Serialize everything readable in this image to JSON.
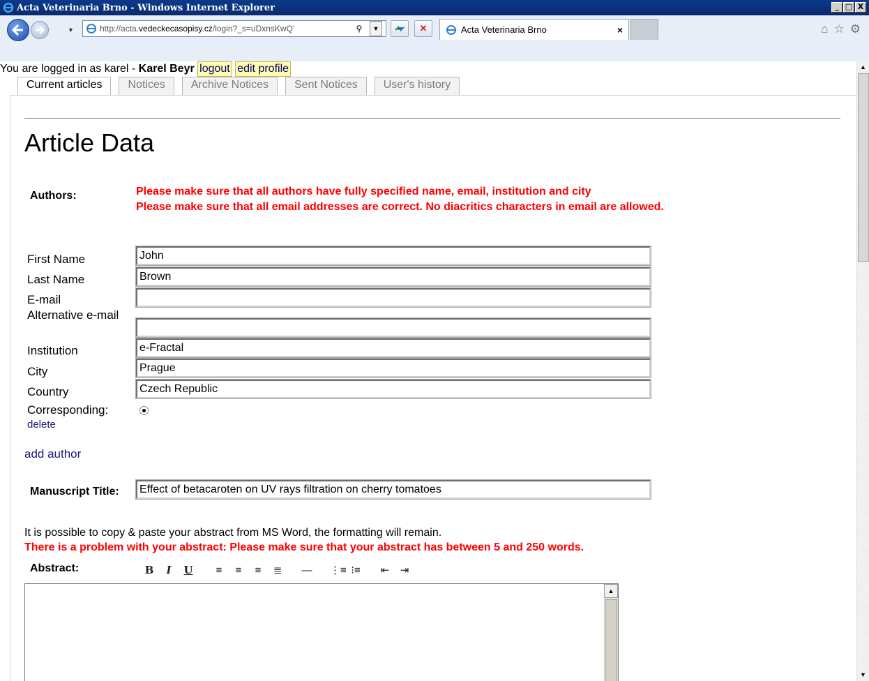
{
  "window": {
    "title": "Acta Veterinaria Brno - Windows Internet Explorer",
    "controls": [
      "_",
      "□",
      "X"
    ]
  },
  "browser": {
    "url_prefix": "http://acta.",
    "url_domain": "vedeckecasopisy.cz",
    "url_rest": "/login?_s=uDxnsKwQ'",
    "tab_title": "Acta Veterinaria Brno",
    "tab_close": "×",
    "icons": [
      "home-icon",
      "star-icon",
      "gear-icon"
    ]
  },
  "session": {
    "logged_in_prefix": "You are logged in as karel - ",
    "user_full_name": "Karel Beyr",
    "logout_label": "logout",
    "edit_profile_label": "edit profile"
  },
  "tabs": [
    {
      "label": "Current articles",
      "active": true
    },
    {
      "label": "Notices",
      "active": false
    },
    {
      "label": "Archive Notices",
      "active": false
    },
    {
      "label": "Sent Notices",
      "active": false
    },
    {
      "label": "User's history",
      "active": false
    }
  ],
  "page": {
    "title": "Article Data",
    "authors_label": "Authors:",
    "warnings": [
      "Please make sure that all authors have fully specified name, email, institution and city",
      "Please make sure that all email addresses are correct. No diacritics characters in email are allowed."
    ]
  },
  "author": {
    "labels": {
      "first_name": "First Name",
      "last_name": "Last Name",
      "email": "E-mail",
      "alt_email": "Alternative e-mail",
      "institution": "Institution",
      "city": "City",
      "country": "Country",
      "corresponding": "Corresponding:"
    },
    "values": {
      "first_name": "John",
      "last_name": "Brown",
      "email": "",
      "alt_email": "",
      "institution": "e-Fractal",
      "city": "Prague",
      "country": "Czech Republic"
    },
    "corresponding_selected": true,
    "delete_label": "delete"
  },
  "add_author_label": "add author",
  "manuscript": {
    "label": "Manuscript Title:",
    "value": "Effect of betacaroten on UV rays filtration on cherry tomatoes"
  },
  "abstract": {
    "hint": "It is possible to copy & paste your abstract from MS Word, the formatting will remain.",
    "error": "There is a problem with your abstract: Please make sure that your abstract has between 5 and 250 words.",
    "label": "Abstract:",
    "toolbar": [
      "B",
      "I",
      "U",
      "align-left",
      "align-center",
      "align-right",
      "align-justify",
      "horizontal-rule",
      "ordered-list",
      "unordered-list",
      "outdent",
      "indent"
    ]
  },
  "colors": {
    "warning": "#ff0000",
    "link": "#1a1a7a",
    "highlight": "#fffda8",
    "titlebar": "#0c3a8c"
  }
}
